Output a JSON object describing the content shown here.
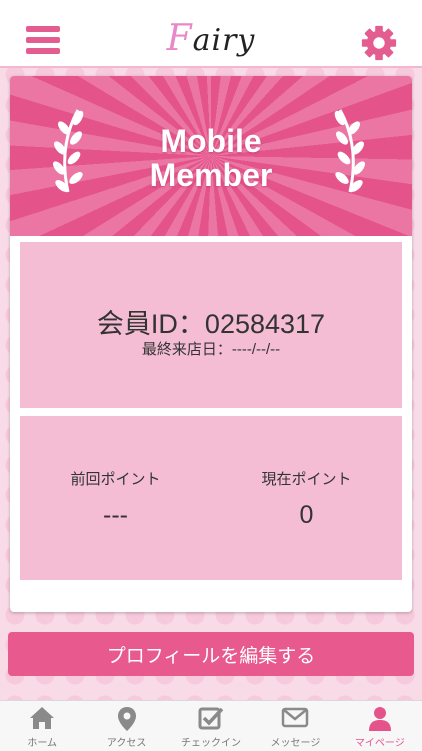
{
  "header": {
    "logo_first": "F",
    "logo_rest": "airy",
    "menu_icon": "hamburger-menu-icon",
    "settings_icon": "gear-icon"
  },
  "banner": {
    "line1": "Mobile",
    "line2": "Member"
  },
  "member": {
    "id_text": "会員ID：02584317",
    "last_visit": "最終来店日：----/--/--"
  },
  "points": {
    "previous_label": "前回ポイント",
    "previous_value": "---",
    "current_label": "現在ポイント",
    "current_value": "0"
  },
  "edit_profile_label": "プロフィールを編集する",
  "tabs": [
    {
      "label": "ホーム",
      "icon": "home-icon"
    },
    {
      "label": "アクセス",
      "icon": "location-pin-icon"
    },
    {
      "label": "チェックイン",
      "icon": "checkbox-icon"
    },
    {
      "label": "メッセージ",
      "icon": "envelope-icon"
    },
    {
      "label": "マイページ",
      "icon": "person-icon"
    }
  ],
  "colors": {
    "accent": "#e4548b",
    "panel": "#f4bdd4",
    "background": "#f9dbe8",
    "tab_inactive": "#8a8a8a"
  }
}
